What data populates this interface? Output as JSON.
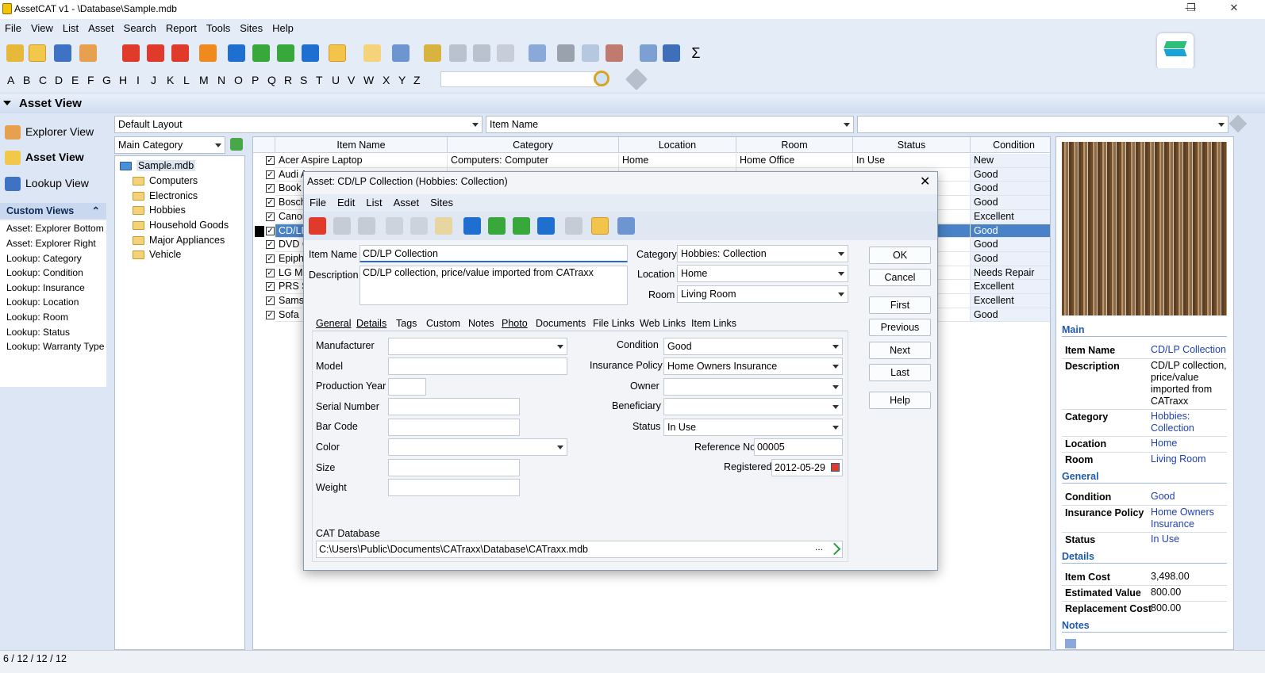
{
  "window": {
    "title": "AssetCAT v1 - \\Database\\Sample.mdb",
    "minimize": "—",
    "maximize": "❐",
    "close": "✕"
  },
  "menu": [
    "File",
    "View",
    "List",
    "Asset",
    "Search",
    "Report",
    "Tools",
    "Sites",
    "Help"
  ],
  "alphabet": [
    "A",
    "B",
    "C",
    "D",
    "E",
    "F",
    "G",
    "H",
    "I",
    "J",
    "K",
    "L",
    "M",
    "N",
    "O",
    "P",
    "Q",
    "R",
    "S",
    "T",
    "U",
    "V",
    "W",
    "X",
    "Y",
    "Z"
  ],
  "view_header": "Asset View",
  "nav": {
    "explorer": "Explorer View",
    "asset": "Asset View",
    "lookup": "Lookup View"
  },
  "custom_views": {
    "header": "Custom Views",
    "items": [
      "Asset: Explorer Bottom",
      "Asset: Explorer Right",
      "Lookup: Category",
      "Lookup: Condition",
      "Lookup: Insurance",
      "Lookup: Location",
      "Lookup: Room",
      "Lookup: Status",
      "Lookup: Warranty Type"
    ]
  },
  "filters": {
    "layout": "Default Layout",
    "field": "Item Name",
    "value": "",
    "group": "Main Category"
  },
  "tree": {
    "root": "Sample.mdb",
    "folders": [
      "Computers",
      "Electronics",
      "Hobbies",
      "Household Goods",
      "Major Appliances",
      "Vehicle"
    ]
  },
  "grid": {
    "columns": [
      "Item Name",
      "Category",
      "Location",
      "Room",
      "Status",
      "Condition"
    ],
    "rows": [
      {
        "name": "Acer Aspire Laptop",
        "category": "Computers: Computer",
        "location": "Home",
        "room": "Home Office",
        "status": "In Use",
        "condition": "New"
      },
      {
        "name": "Audi A",
        "category": "",
        "location": "",
        "room": "",
        "status": "",
        "condition": "Good"
      },
      {
        "name": "Book",
        "category": "",
        "location": "",
        "room": "",
        "status": "",
        "condition": "Good"
      },
      {
        "name": "Bosch",
        "category": "",
        "location": "",
        "room": "",
        "status": "",
        "condition": "Good"
      },
      {
        "name": "Canon",
        "category": "",
        "location": "",
        "room": "",
        "status": "",
        "condition": "Excellent"
      },
      {
        "name": "CD/LP",
        "category": "",
        "location": "",
        "room": "",
        "status": "",
        "condition": "Good"
      },
      {
        "name": "DVD C",
        "category": "",
        "location": "",
        "room": "",
        "status": "",
        "condition": "Good"
      },
      {
        "name": "Epiph",
        "category": "",
        "location": "",
        "room": "",
        "status": "",
        "condition": "Good"
      },
      {
        "name": "LG Mi",
        "category": "",
        "location": "",
        "room": "",
        "status": "",
        "condition": "Needs Repair"
      },
      {
        "name": "PRS SE",
        "category": "",
        "location": "",
        "room": "",
        "status": "",
        "condition": "Excellent"
      },
      {
        "name": "Samsu",
        "category": "",
        "location": "",
        "room": "",
        "status": "",
        "condition": "Excellent"
      },
      {
        "name": "Sofa",
        "category": "",
        "location": "",
        "room": "",
        "status": "",
        "condition": "Good"
      }
    ],
    "selected_index": 5
  },
  "details_panel": {
    "main_header": "Main",
    "item_name_label": "Item Name",
    "item_name": "CD/LP Collection",
    "description_label": "Description",
    "description": "CD/LP collection, price/value imported from CATraxx",
    "category_label": "Category",
    "category": "Hobbies: Collection",
    "location_label": "Location",
    "location": "Home",
    "room_label": "Room",
    "room": "Living Room",
    "general_header": "General",
    "condition_label": "Condition",
    "condition": "Good",
    "insurance_label": "Insurance Policy",
    "insurance": "Home Owners Insurance",
    "status_label": "Status",
    "status": "In Use",
    "details_header": "Details",
    "cost_label": "Item Cost",
    "cost": "3,498.00",
    "est_label": "Estimated Value",
    "est": "800.00",
    "repl_label": "Replacement Cost",
    "repl": "800.00",
    "notes_header": "Notes"
  },
  "status_bar": "6 / 12 / 12 / 12",
  "dialog": {
    "title": "Asset: CD/LP Collection (Hobbies: Collection)",
    "menu": [
      "File",
      "Edit",
      "List",
      "Asset",
      "Sites"
    ],
    "item_name_label": "Item Name",
    "item_name": "CD/LP Collection",
    "description_label": "Description",
    "description": "CD/LP collection, price/value imported from CATraxx",
    "category_label": "Category",
    "category": "Hobbies: Collection",
    "location_label": "Location",
    "location": "Home",
    "room_label": "Room",
    "room": "Living Room",
    "buttons": {
      "ok": "OK",
      "cancel": "Cancel",
      "first": "First",
      "previous": "Previous",
      "next": "Next",
      "last": "Last",
      "help": "Help"
    },
    "tabs": [
      "General",
      "Details",
      "Tags",
      "Custom",
      "Notes",
      "Photo",
      "Documents",
      "File Links",
      "Web Links",
      "Item Links"
    ],
    "fields": {
      "manufacturer_label": "Manufacturer",
      "manufacturer": "",
      "model_label": "Model",
      "model": "",
      "year_label": "Production Year",
      "year": "",
      "serial_label": "Serial Number",
      "serial": "",
      "barcode_label": "Bar Code",
      "barcode": "",
      "color_label": "Color",
      "color": "",
      "size_label": "Size",
      "size": "",
      "weight_label": "Weight",
      "weight": "",
      "condition_label": "Condition",
      "condition": "Good",
      "insurance_label": "Insurance Policy",
      "insurance": "Home Owners Insurance",
      "owner_label": "Owner",
      "owner": "",
      "beneficiary_label": "Beneficiary",
      "beneficiary": "",
      "status_label": "Status",
      "status": "In Use",
      "refno_label": "Reference No",
      "refno": "00005",
      "registered_label": "Registered",
      "registered": "2012-05-29"
    },
    "db_label": "CAT Database",
    "db_path": "C:\\Users\\Public\\Documents\\CATraxx\\Database\\CATraxx.mdb",
    "db_browse": "..."
  }
}
